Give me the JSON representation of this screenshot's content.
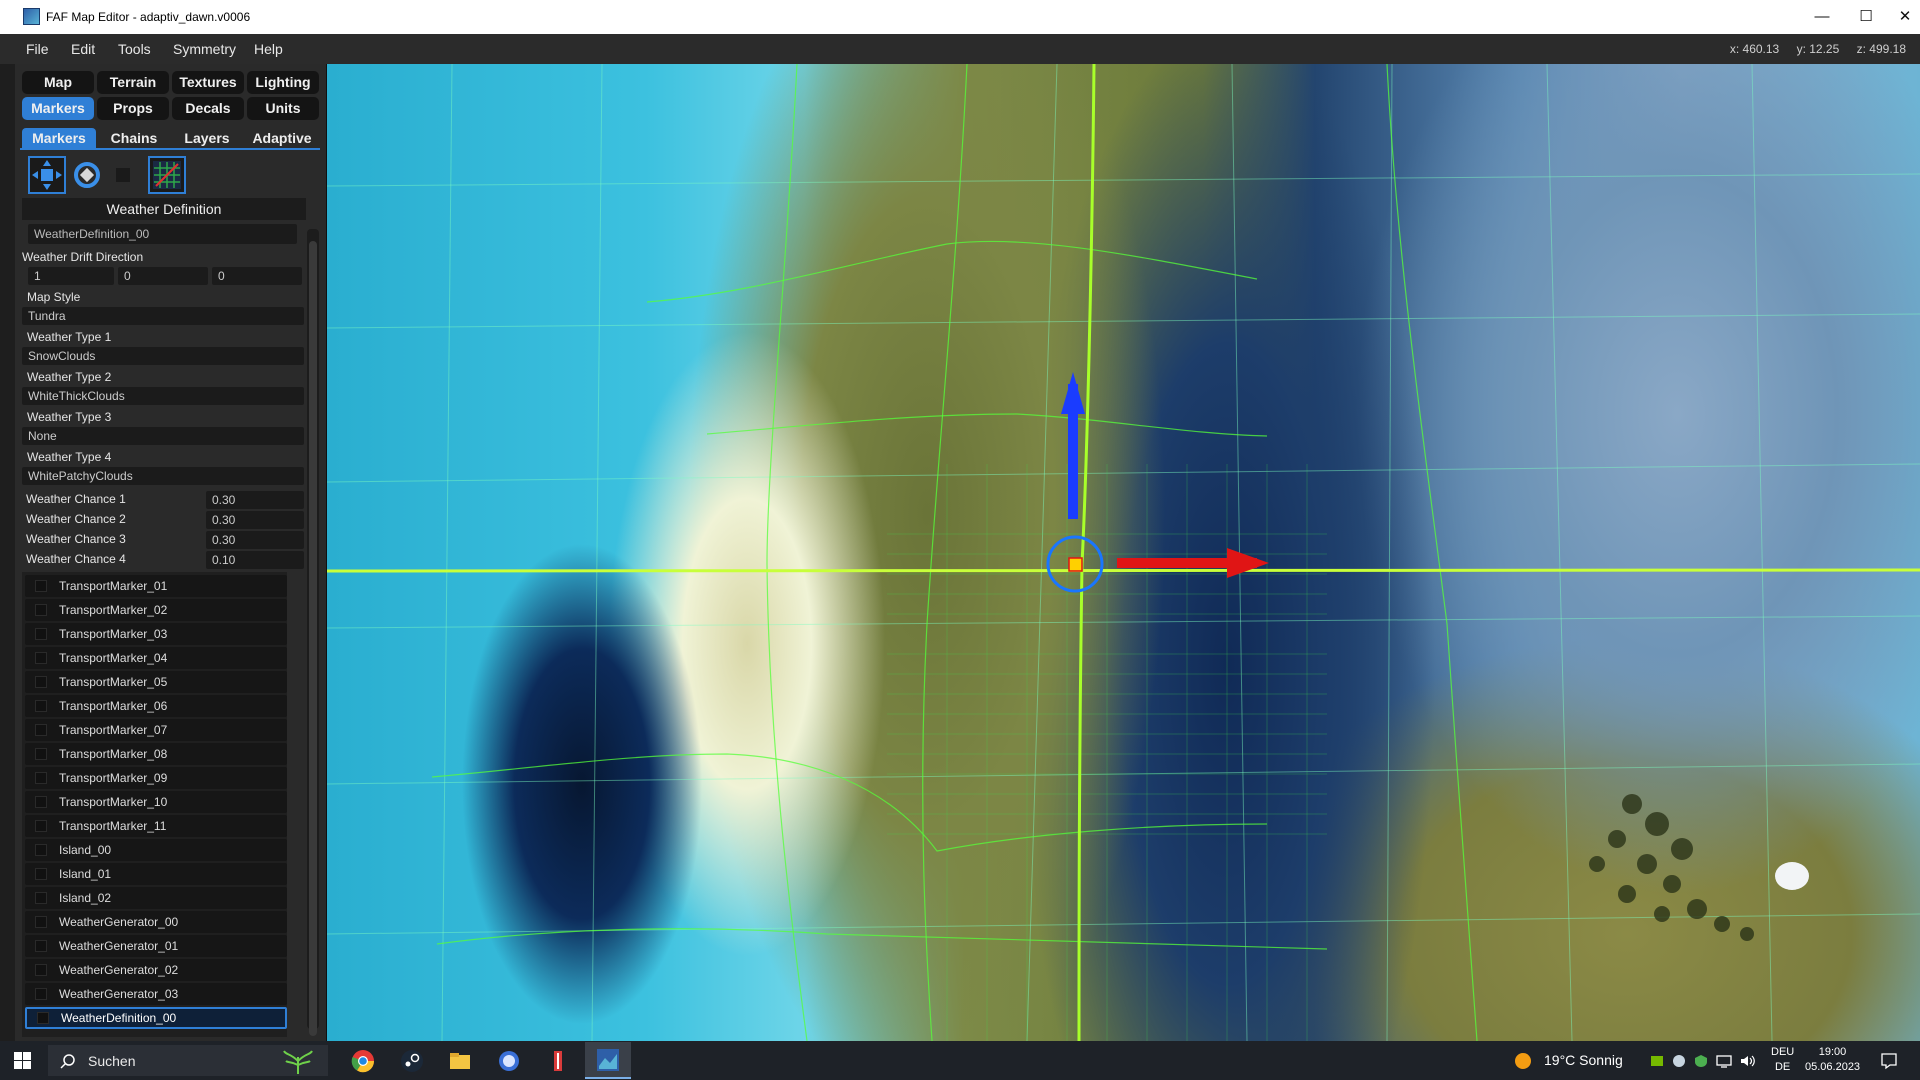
{
  "window": {
    "title": "FAF Map Editor - adaptiv_dawn.v0006",
    "minimize": "—",
    "maximize": "☐",
    "close": "✕"
  },
  "menu": [
    "File",
    "Edit",
    "Tools",
    "Symmetry",
    "Help"
  ],
  "coords": {
    "x": "x: 460.13",
    "y": "y: 12.25",
    "z": "z: 499.18"
  },
  "main_tabs": [
    {
      "label": "Map",
      "active": false
    },
    {
      "label": "Terrain",
      "active": false
    },
    {
      "label": "Textures",
      "active": false
    },
    {
      "label": "Lighting",
      "active": false
    },
    {
      "label": "Markers",
      "active": true
    },
    {
      "label": "Props",
      "active": false
    },
    {
      "label": "Decals",
      "active": false
    },
    {
      "label": "Units",
      "active": false
    }
  ],
  "sub_tabs": [
    {
      "label": "Markers",
      "active": true
    },
    {
      "label": "Chains",
      "active": false
    },
    {
      "label": "Layers",
      "active": false
    },
    {
      "label": "Adaptive",
      "active": false
    }
  ],
  "tools": [
    "move-tool-icon",
    "rotate-tool-icon",
    "blank-tool-icon",
    "grid-snap-icon"
  ],
  "weather": {
    "section_title": "Weather Definition",
    "name_value": "WeatherDefinition_00",
    "drift_label": "Weather Drift Direction",
    "drift": [
      "1",
      "0",
      "0"
    ],
    "map_style_label": "Map Style",
    "map_style": "Tundra",
    "type1_label": "Weather Type 1",
    "type1": "SnowClouds",
    "type2_label": "Weather Type 2",
    "type2": "WhiteThickClouds",
    "type3_label": "Weather Type 3",
    "type3": "None",
    "type4_label": "Weather Type 4",
    "type4": "WhitePatchyClouds",
    "chances": [
      {
        "label": "Weather Chance 1",
        "value": "0.30"
      },
      {
        "label": "Weather Chance 2",
        "value": "0.30"
      },
      {
        "label": "Weather Chance 3",
        "value": "0.30"
      },
      {
        "label": "Weather Chance 4",
        "value": "0.10"
      }
    ]
  },
  "markers": [
    "TransportMarker_01",
    "TransportMarker_02",
    "TransportMarker_03",
    "TransportMarker_04",
    "TransportMarker_05",
    "TransportMarker_06",
    "TransportMarker_07",
    "TransportMarker_08",
    "TransportMarker_09",
    "TransportMarker_10",
    "TransportMarker_11",
    "Island_00",
    "Island_01",
    "Island_02",
    "WeatherGenerator_00",
    "WeatherGenerator_01",
    "WeatherGenerator_02",
    "WeatherGenerator_03",
    "WeatherDefinition_00"
  ],
  "selected_marker": "WeatherDefinition_00",
  "taskbar": {
    "search_placeholder": "Suchen",
    "weather": "19°C  Sonnig",
    "lang_line1": "DEU",
    "lang_line2": "DE",
    "time": "19:00",
    "date": "05.06.2023"
  },
  "colors": {
    "accent": "#2f7fd6",
    "grid": "#5bff3a",
    "axis_x": "#e01515",
    "axis_y": "#1a3cff"
  }
}
